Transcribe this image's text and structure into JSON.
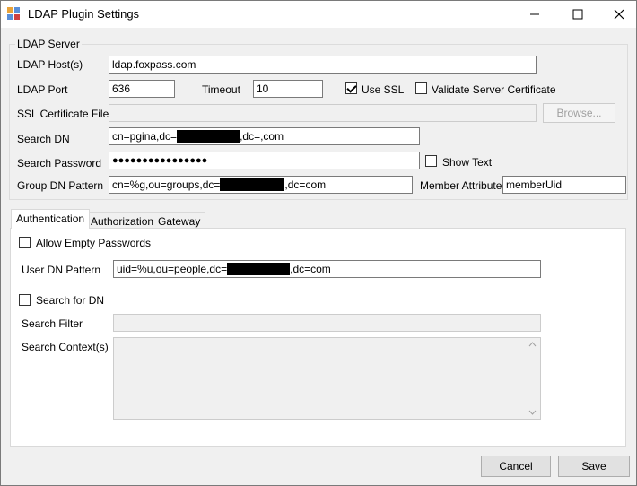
{
  "window": {
    "title": "LDAP Plugin Settings"
  },
  "ldap_server": {
    "group_label": "LDAP Server",
    "host_label": "LDAP Host(s)",
    "host_value": "ldap.foxpass.com",
    "port_label": "LDAP Port",
    "port_value": "636",
    "timeout_label": "Timeout",
    "timeout_value": "10",
    "use_ssl_label": "Use SSL",
    "use_ssl_checked": true,
    "validate_cert_label": "Validate Server Certificate",
    "validate_cert_checked": false,
    "ssl_cert_label": "SSL Certificate File",
    "ssl_cert_value": "",
    "browse_label": "Browse...",
    "search_dn_label": "Search DN",
    "search_dn_prefix": "cn=pgina,dc=",
    "search_dn_suffix": ",dc=,com",
    "search_password_label": "Search Password",
    "search_password_mask": "●●●●●●●●●●●●●●●●",
    "show_text_label": "Show Text",
    "show_text_checked": false,
    "group_dn_label": "Group DN Pattern",
    "group_dn_prefix": "cn=%g,ou=groups,dc=",
    "group_dn_suffix": ",dc=com",
    "member_attr_label": "Member Attribute",
    "member_attr_value": "memberUid"
  },
  "tabs": [
    {
      "label": "Authentication",
      "active": true
    },
    {
      "label": "Authorization",
      "active": false
    },
    {
      "label": "Gateway",
      "active": false
    }
  ],
  "authentication": {
    "allow_empty_label": "Allow Empty Passwords",
    "allow_empty_checked": false,
    "user_dn_label": "User DN Pattern",
    "user_dn_prefix": "uid=%u,ou=people,dc=",
    "user_dn_suffix": ",dc=com",
    "search_for_dn_label": "Search for DN",
    "search_for_dn_checked": false,
    "search_filter_label": "Search Filter",
    "search_filter_value": "",
    "search_context_label": "Search Context(s)"
  },
  "footer": {
    "cancel_label": "Cancel",
    "save_label": "Save"
  },
  "colors": {
    "window_bg": "#f0f0f0",
    "field_border": "#7a7a7a",
    "redaction": "#000000"
  }
}
